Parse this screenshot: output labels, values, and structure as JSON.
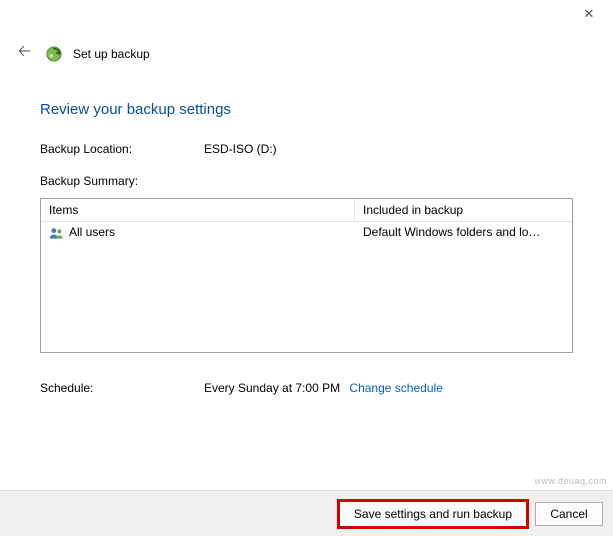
{
  "window": {
    "title": "Set up backup"
  },
  "page": {
    "heading": "Review your backup settings",
    "backup_location_label": "Backup Location:",
    "backup_location_value": "ESD-ISO (D:)",
    "backup_summary_label": "Backup Summary:"
  },
  "grid": {
    "headers": {
      "items": "Items",
      "included": "Included in backup"
    },
    "rows": [
      {
        "item": "All users",
        "included": "Default Windows folders and lo…"
      }
    ]
  },
  "schedule": {
    "label": "Schedule:",
    "value": "Every Sunday at 7:00 PM",
    "change_link": "Change schedule"
  },
  "buttons": {
    "save": "Save settings and run backup",
    "cancel": "Cancel"
  },
  "watermark": "www.deuaq.com"
}
